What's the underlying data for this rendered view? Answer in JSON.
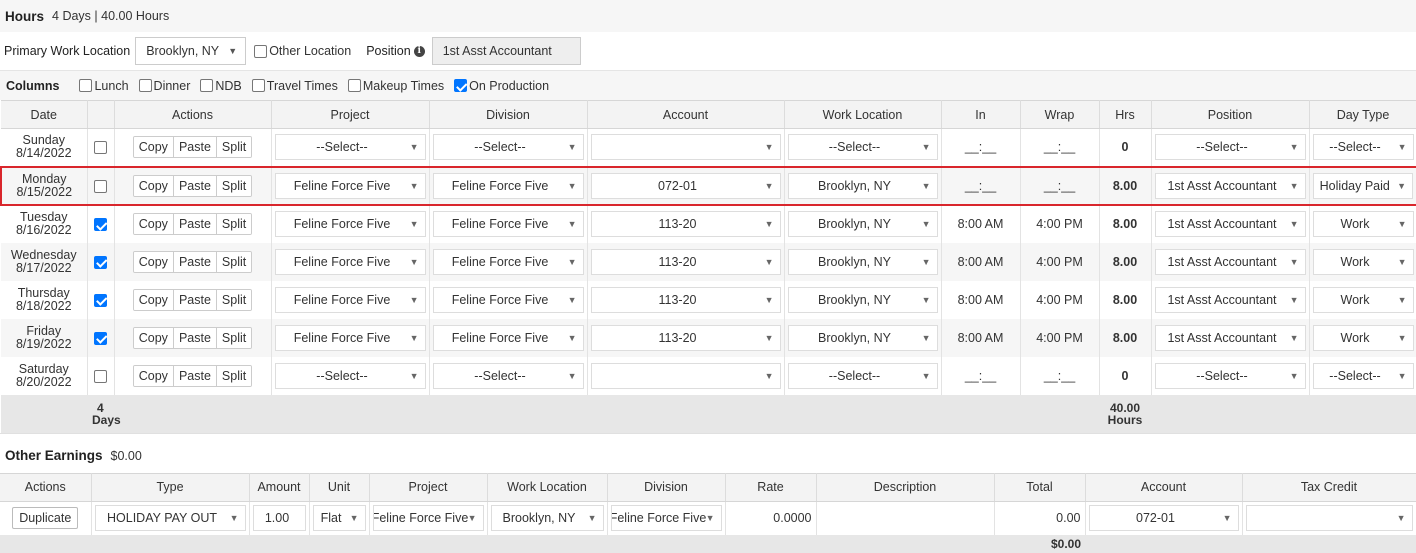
{
  "hours_section": {
    "title": "Hours",
    "summary": "4 Days | 40.00 Hours"
  },
  "location_row": {
    "primary_label": "Primary Work Location",
    "primary_value": "Brooklyn, NY",
    "other_location_label": "Other Location",
    "position_label": "Position",
    "position_value": "1st Asst Accountant"
  },
  "columns_row": {
    "label": "Columns",
    "options": [
      {
        "label": "Lunch",
        "checked": false
      },
      {
        "label": "Dinner",
        "checked": false
      },
      {
        "label": "NDB",
        "checked": false
      },
      {
        "label": "Travel Times",
        "checked": false
      },
      {
        "label": "Makeup Times",
        "checked": false
      },
      {
        "label": "On Production",
        "checked": true
      }
    ]
  },
  "hours_table": {
    "headers": [
      "Date",
      "",
      "Actions",
      "Project",
      "Division",
      "Account",
      "Work Location",
      "In",
      "Wrap",
      "Hrs",
      "Position",
      "Day Type"
    ],
    "action_labels": [
      "Copy",
      "Paste",
      "Split"
    ],
    "rows": [
      {
        "day": "Sunday",
        "date": "8/14/2022",
        "checked": false,
        "project": "--Select--",
        "division": "--Select--",
        "account": "",
        "location": "--Select--",
        "in": "__:__",
        "wrap": "__:__",
        "hrs": "0",
        "position": "--Select--",
        "day_type": "--Select--",
        "highlight": false
      },
      {
        "day": "Monday",
        "date": "8/15/2022",
        "checked": false,
        "project": "Feline Force Five",
        "division": "Feline Force Five",
        "account": "072-01",
        "location": "Brooklyn, NY",
        "in": "__:__",
        "wrap": "__:__",
        "hrs": "8.00",
        "position": "1st Asst Accountant",
        "day_type": "Holiday Paid",
        "highlight": true
      },
      {
        "day": "Tuesday",
        "date": "8/16/2022",
        "checked": true,
        "project": "Feline Force Five",
        "division": "Feline Force Five",
        "account": "113-20",
        "location": "Brooklyn, NY",
        "in": "8:00 AM",
        "wrap": "4:00 PM",
        "hrs": "8.00",
        "position": "1st Asst Accountant",
        "day_type": "Work",
        "highlight": false
      },
      {
        "day": "Wednesday",
        "date": "8/17/2022",
        "checked": true,
        "project": "Feline Force Five",
        "division": "Feline Force Five",
        "account": "113-20",
        "location": "Brooklyn, NY",
        "in": "8:00 AM",
        "wrap": "4:00 PM",
        "hrs": "8.00",
        "position": "1st Asst Accountant",
        "day_type": "Work",
        "highlight": false
      },
      {
        "day": "Thursday",
        "date": "8/18/2022",
        "checked": true,
        "project": "Feline Force Five",
        "division": "Feline Force Five",
        "account": "113-20",
        "location": "Brooklyn, NY",
        "in": "8:00 AM",
        "wrap": "4:00 PM",
        "hrs": "8.00",
        "position": "1st Asst Accountant",
        "day_type": "Work",
        "highlight": false
      },
      {
        "day": "Friday",
        "date": "8/19/2022",
        "checked": true,
        "project": "Feline Force Five",
        "division": "Feline Force Five",
        "account": "113-20",
        "location": "Brooklyn, NY",
        "in": "8:00 AM",
        "wrap": "4:00 PM",
        "hrs": "8.00",
        "position": "1st Asst Accountant",
        "day_type": "Work",
        "highlight": false
      },
      {
        "day": "Saturday",
        "date": "8/20/2022",
        "checked": false,
        "project": "--Select--",
        "division": "--Select--",
        "account": "",
        "location": "--Select--",
        "in": "__:__",
        "wrap": "__:__",
        "hrs": "0",
        "position": "--Select--",
        "day_type": "--Select--",
        "highlight": false
      }
    ],
    "totals": {
      "days_value": "4",
      "days_label": "Days",
      "hours_value": "40.00",
      "hours_label": "Hours"
    }
  },
  "other_earnings": {
    "title": "Other Earnings",
    "amount": "$0.00",
    "headers": [
      "Actions",
      "Type",
      "Amount",
      "Unit",
      "Project",
      "Work Location",
      "Division",
      "Rate",
      "Description",
      "Total",
      "Account",
      "Tax Credit"
    ],
    "row": {
      "action": "Duplicate",
      "type": "HOLIDAY PAY OUT",
      "amount": "1.00",
      "unit": "Flat",
      "project": "Feline Force Five",
      "location": "Brooklyn, NY",
      "division": "Feline Force Five",
      "rate": "0.0000",
      "description": "",
      "total": "0.00",
      "account": "072-01",
      "tax_credit": ""
    },
    "grand_total": "$0.00"
  },
  "colors": {
    "highlight_border": "#d9262c",
    "checkbox_checked": "#0075ff",
    "header_bg": "#f3f3f3",
    "totals_bg": "#e7e7e7"
  }
}
